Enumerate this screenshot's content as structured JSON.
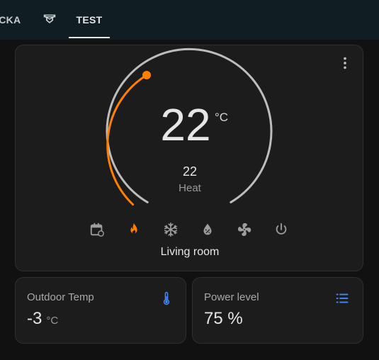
{
  "tabs": {
    "partial_label": "ICKA",
    "icon_tab": "robot-vacuum-icon",
    "active_label": "TEST"
  },
  "thermostat": {
    "current_temp": "22",
    "unit": "°C",
    "target_temp": "22",
    "mode": "Heat",
    "name": "Living room",
    "heat_color": "#ff7f00",
    "track_color": "#bdbdbd",
    "modes": [
      {
        "icon": "calendar-sync-icon",
        "active": false
      },
      {
        "icon": "fire-icon",
        "active": true
      },
      {
        "icon": "snowflake-icon",
        "active": false
      },
      {
        "icon": "water-percent-icon",
        "active": false
      },
      {
        "icon": "fan-icon",
        "active": false
      },
      {
        "icon": "power-icon",
        "active": false
      }
    ],
    "menu_icon": "dots-vertical-icon"
  },
  "outdoor": {
    "title": "Outdoor Temp",
    "value": "-3",
    "unit": "°C",
    "icon": "thermometer-icon",
    "icon_color": "#448aff"
  },
  "power": {
    "title": "Power level",
    "value": "75 %",
    "icon": "format-list-bulleted-icon",
    "icon_color": "#448aff"
  }
}
